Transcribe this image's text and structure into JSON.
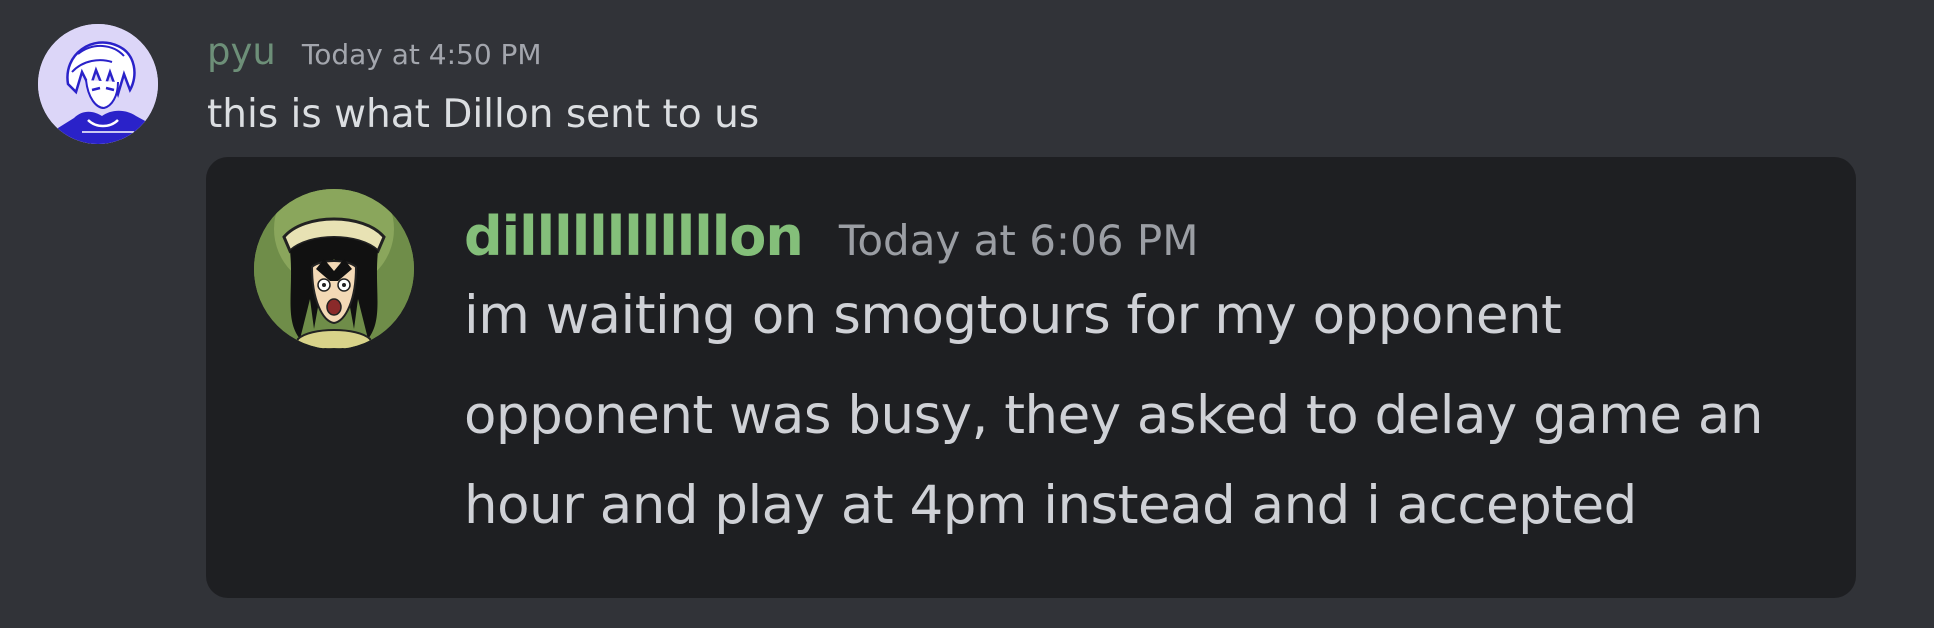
{
  "message": {
    "author": {
      "username": "pyu",
      "username_color": "#6d8f78",
      "avatar_icon": "anime-character-avatar-icon"
    },
    "timestamp": "Today at 4:50 PM",
    "text": "this is what Dillon sent to us",
    "embed": {
      "author": {
        "username": "dillllllllllllon",
        "username_color": "#84bf7a",
        "avatar_icon": "cartoon-character-avatar-icon"
      },
      "timestamp": "Today at 6:06 PM",
      "lines": [
        "im waiting on smogtours for my opponent",
        "opponent was busy, they asked to delay game an",
        "hour and play at 4pm instead and i accepted"
      ]
    }
  },
  "colors": {
    "background": "#313338",
    "embed_background": "#1e1f22",
    "text": "#dbdee1",
    "timestamp": "#a3a6ad"
  }
}
